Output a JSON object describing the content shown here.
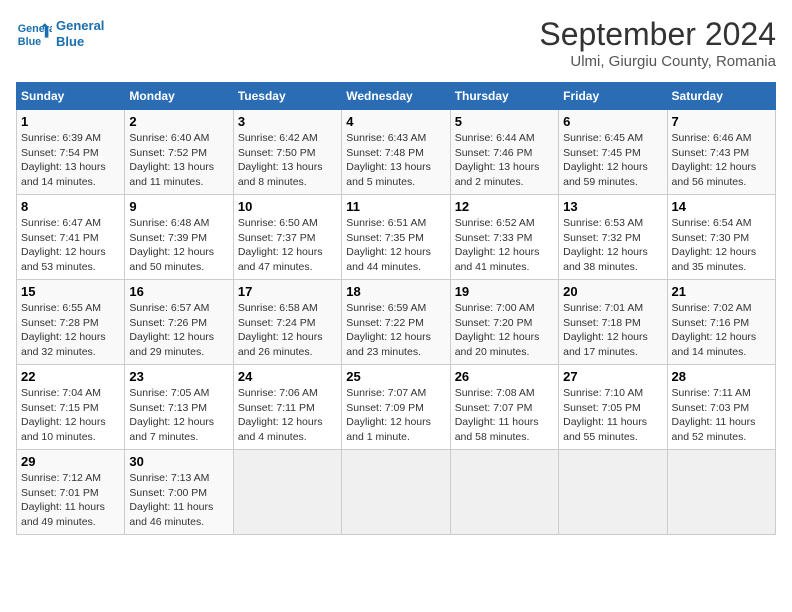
{
  "header": {
    "logo_line1": "General",
    "logo_line2": "Blue",
    "title": "September 2024",
    "subtitle": "Ulmi, Giurgiu County, Romania"
  },
  "columns": [
    "Sunday",
    "Monday",
    "Tuesday",
    "Wednesday",
    "Thursday",
    "Friday",
    "Saturday"
  ],
  "weeks": [
    [
      {
        "day": "1",
        "info": "Sunrise: 6:39 AM\nSunset: 7:54 PM\nDaylight: 13 hours\nand 14 minutes."
      },
      {
        "day": "2",
        "info": "Sunrise: 6:40 AM\nSunset: 7:52 PM\nDaylight: 13 hours\nand 11 minutes."
      },
      {
        "day": "3",
        "info": "Sunrise: 6:42 AM\nSunset: 7:50 PM\nDaylight: 13 hours\nand 8 minutes."
      },
      {
        "day": "4",
        "info": "Sunrise: 6:43 AM\nSunset: 7:48 PM\nDaylight: 13 hours\nand 5 minutes."
      },
      {
        "day": "5",
        "info": "Sunrise: 6:44 AM\nSunset: 7:46 PM\nDaylight: 13 hours\nand 2 minutes."
      },
      {
        "day": "6",
        "info": "Sunrise: 6:45 AM\nSunset: 7:45 PM\nDaylight: 12 hours\nand 59 minutes."
      },
      {
        "day": "7",
        "info": "Sunrise: 6:46 AM\nSunset: 7:43 PM\nDaylight: 12 hours\nand 56 minutes."
      }
    ],
    [
      {
        "day": "8",
        "info": "Sunrise: 6:47 AM\nSunset: 7:41 PM\nDaylight: 12 hours\nand 53 minutes."
      },
      {
        "day": "9",
        "info": "Sunrise: 6:48 AM\nSunset: 7:39 PM\nDaylight: 12 hours\nand 50 minutes."
      },
      {
        "day": "10",
        "info": "Sunrise: 6:50 AM\nSunset: 7:37 PM\nDaylight: 12 hours\nand 47 minutes."
      },
      {
        "day": "11",
        "info": "Sunrise: 6:51 AM\nSunset: 7:35 PM\nDaylight: 12 hours\nand 44 minutes."
      },
      {
        "day": "12",
        "info": "Sunrise: 6:52 AM\nSunset: 7:33 PM\nDaylight: 12 hours\nand 41 minutes."
      },
      {
        "day": "13",
        "info": "Sunrise: 6:53 AM\nSunset: 7:32 PM\nDaylight: 12 hours\nand 38 minutes."
      },
      {
        "day": "14",
        "info": "Sunrise: 6:54 AM\nSunset: 7:30 PM\nDaylight: 12 hours\nand 35 minutes."
      }
    ],
    [
      {
        "day": "15",
        "info": "Sunrise: 6:55 AM\nSunset: 7:28 PM\nDaylight: 12 hours\nand 32 minutes."
      },
      {
        "day": "16",
        "info": "Sunrise: 6:57 AM\nSunset: 7:26 PM\nDaylight: 12 hours\nand 29 minutes."
      },
      {
        "day": "17",
        "info": "Sunrise: 6:58 AM\nSunset: 7:24 PM\nDaylight: 12 hours\nand 26 minutes."
      },
      {
        "day": "18",
        "info": "Sunrise: 6:59 AM\nSunset: 7:22 PM\nDaylight: 12 hours\nand 23 minutes."
      },
      {
        "day": "19",
        "info": "Sunrise: 7:00 AM\nSunset: 7:20 PM\nDaylight: 12 hours\nand 20 minutes."
      },
      {
        "day": "20",
        "info": "Sunrise: 7:01 AM\nSunset: 7:18 PM\nDaylight: 12 hours\nand 17 minutes."
      },
      {
        "day": "21",
        "info": "Sunrise: 7:02 AM\nSunset: 7:16 PM\nDaylight: 12 hours\nand 14 minutes."
      }
    ],
    [
      {
        "day": "22",
        "info": "Sunrise: 7:04 AM\nSunset: 7:15 PM\nDaylight: 12 hours\nand 10 minutes."
      },
      {
        "day": "23",
        "info": "Sunrise: 7:05 AM\nSunset: 7:13 PM\nDaylight: 12 hours\nand 7 minutes."
      },
      {
        "day": "24",
        "info": "Sunrise: 7:06 AM\nSunset: 7:11 PM\nDaylight: 12 hours\nand 4 minutes."
      },
      {
        "day": "25",
        "info": "Sunrise: 7:07 AM\nSunset: 7:09 PM\nDaylight: 12 hours\nand 1 minute."
      },
      {
        "day": "26",
        "info": "Sunrise: 7:08 AM\nSunset: 7:07 PM\nDaylight: 11 hours\nand 58 minutes."
      },
      {
        "day": "27",
        "info": "Sunrise: 7:10 AM\nSunset: 7:05 PM\nDaylight: 11 hours\nand 55 minutes."
      },
      {
        "day": "28",
        "info": "Sunrise: 7:11 AM\nSunset: 7:03 PM\nDaylight: 11 hours\nand 52 minutes."
      }
    ],
    [
      {
        "day": "29",
        "info": "Sunrise: 7:12 AM\nSunset: 7:01 PM\nDaylight: 11 hours\nand 49 minutes."
      },
      {
        "day": "30",
        "info": "Sunrise: 7:13 AM\nSunset: 7:00 PM\nDaylight: 11 hours\nand 46 minutes."
      },
      {
        "day": "",
        "info": ""
      },
      {
        "day": "",
        "info": ""
      },
      {
        "day": "",
        "info": ""
      },
      {
        "day": "",
        "info": ""
      },
      {
        "day": "",
        "info": ""
      }
    ]
  ]
}
